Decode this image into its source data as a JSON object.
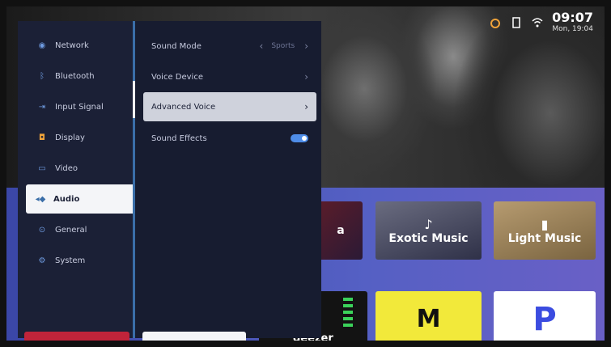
{
  "status": {
    "time": "09:07",
    "date": "Mon, 19:04",
    "icons": [
      "notification-icon",
      "sd-card-icon",
      "wifi-icon"
    ]
  },
  "settings_menu": {
    "items": [
      {
        "label": "Network",
        "icon": "network-icon"
      },
      {
        "label": "Bluetooth",
        "icon": "bluetooth-icon"
      },
      {
        "label": "Input Signal",
        "icon": "input-icon"
      },
      {
        "label": "Display",
        "icon": "display-icon"
      },
      {
        "label": "Video",
        "icon": "video-icon"
      },
      {
        "label": "Audio",
        "icon": "audio-icon"
      },
      {
        "label": "General",
        "icon": "general-icon"
      },
      {
        "label": "System",
        "icon": "system-icon"
      }
    ],
    "selected": "Audio"
  },
  "audio_options": [
    {
      "label": "Sound Mode",
      "value": "Sports"
    },
    {
      "label": "Voice Device",
      "value": ""
    },
    {
      "label": "Advanced Voice",
      "value": ""
    },
    {
      "label": "Sound Effects",
      "value": "",
      "toggle_on": true
    }
  ],
  "tiles": [
    {
      "label": "Exotic Music"
    },
    {
      "label": "Light Music"
    },
    {
      "label": "deezer"
    }
  ],
  "colors": {
    "accent": "#4f8de8",
    "panel": "#1b2036",
    "band": "#5560c4"
  }
}
